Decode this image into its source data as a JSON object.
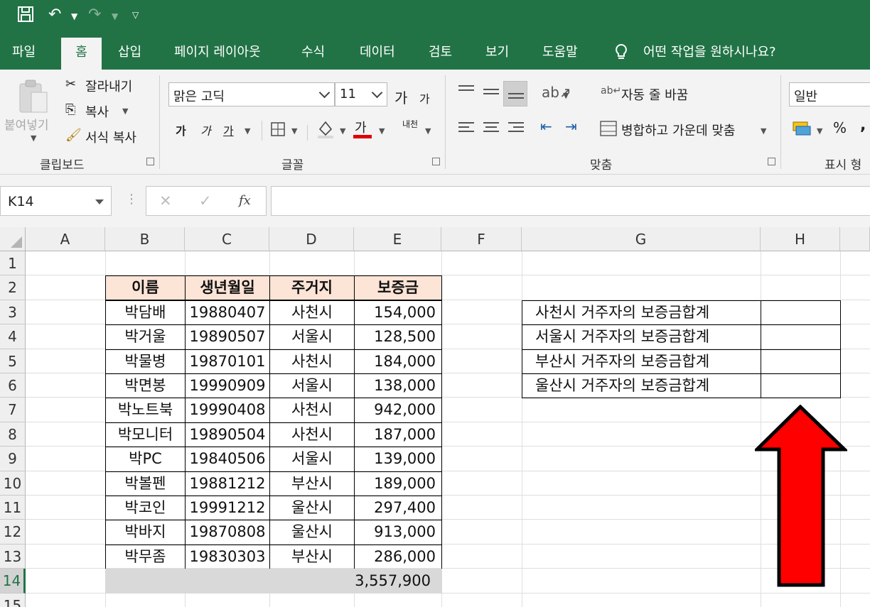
{
  "ribbon_tabs": [
    "파일",
    "홈",
    "삽입",
    "페이지 레이아웃",
    "수식",
    "데이터",
    "검토",
    "보기",
    "도움말"
  ],
  "tell_me": "어떤 작업을 원하시나요?",
  "clipboard": {
    "paste": "붙여넣기",
    "cut": "잘라내기",
    "copy": "복사",
    "format_painter": "서식 복사",
    "group_label": "클립보드"
  },
  "font": {
    "font_name": "맑은 고딕",
    "font_size": "11",
    "grow": "가",
    "shrink": "가",
    "bold": "가",
    "italic": "가",
    "underline": "가",
    "font_color_sample": "가",
    "phonetic": "내천",
    "group_label": "글꼴"
  },
  "alignment": {
    "wrap_text": "자동 줄 바꿈",
    "merge_center": "병합하고 가운데 맞춤",
    "group_label": "맞춤"
  },
  "number": {
    "format": "일반",
    "percent": "%",
    "comma": ",",
    "group_label": "표시 형"
  },
  "formula_bar": {
    "name_box": "K14",
    "cancel": "✕",
    "enter": "✓",
    "fx": "fx",
    "formula": ""
  },
  "sheet": {
    "columns": [
      "A",
      "B",
      "C",
      "D",
      "E",
      "F",
      "G",
      "H"
    ],
    "rows": [
      "1",
      "2",
      "3",
      "4",
      "5",
      "6",
      "7",
      "8",
      "9",
      "10",
      "11",
      "12",
      "13",
      "14",
      "15"
    ],
    "selected_row": "14",
    "table_headers": [
      "이름",
      "생년월일",
      "주거지",
      "보증금"
    ],
    "table_rows": [
      [
        "박담배",
        "19880407",
        "사천시",
        "154,000"
      ],
      [
        "박거울",
        "19890507",
        "서울시",
        "128,500"
      ],
      [
        "박물병",
        "19870101",
        "사천시",
        "184,000"
      ],
      [
        "박면봉",
        "19990909",
        "서울시",
        "138,000"
      ],
      [
        "박노트북",
        "19990408",
        "사천시",
        "942,000"
      ],
      [
        "박모니터",
        "19890504",
        "사천시",
        "187,000"
      ],
      [
        "박PC",
        "19840506",
        "서울시",
        "139,000"
      ],
      [
        "박볼펜",
        "19881212",
        "부산시",
        "189,000"
      ],
      [
        "박코인",
        "19991212",
        "울산시",
        "297,400"
      ],
      [
        "박바지",
        "19870808",
        "울산시",
        "913,000"
      ],
      [
        "박무좀",
        "19830303",
        "부산시",
        "286,000"
      ]
    ],
    "total": "3,557,900",
    "summary_labels": [
      "사천시 거주자의 보증금합계",
      "서울시 거주자의 보증금합계",
      "부산시 거주자의 보증금합계",
      "울산시 거주자의 보증금합계"
    ],
    "summary_values": [
      "",
      "",
      "",
      ""
    ]
  },
  "colors": {
    "excel_green": "#217346",
    "header_fill": "#fce4d6",
    "total_fill": "#d9d9d9",
    "arrow": "#ff0000"
  }
}
